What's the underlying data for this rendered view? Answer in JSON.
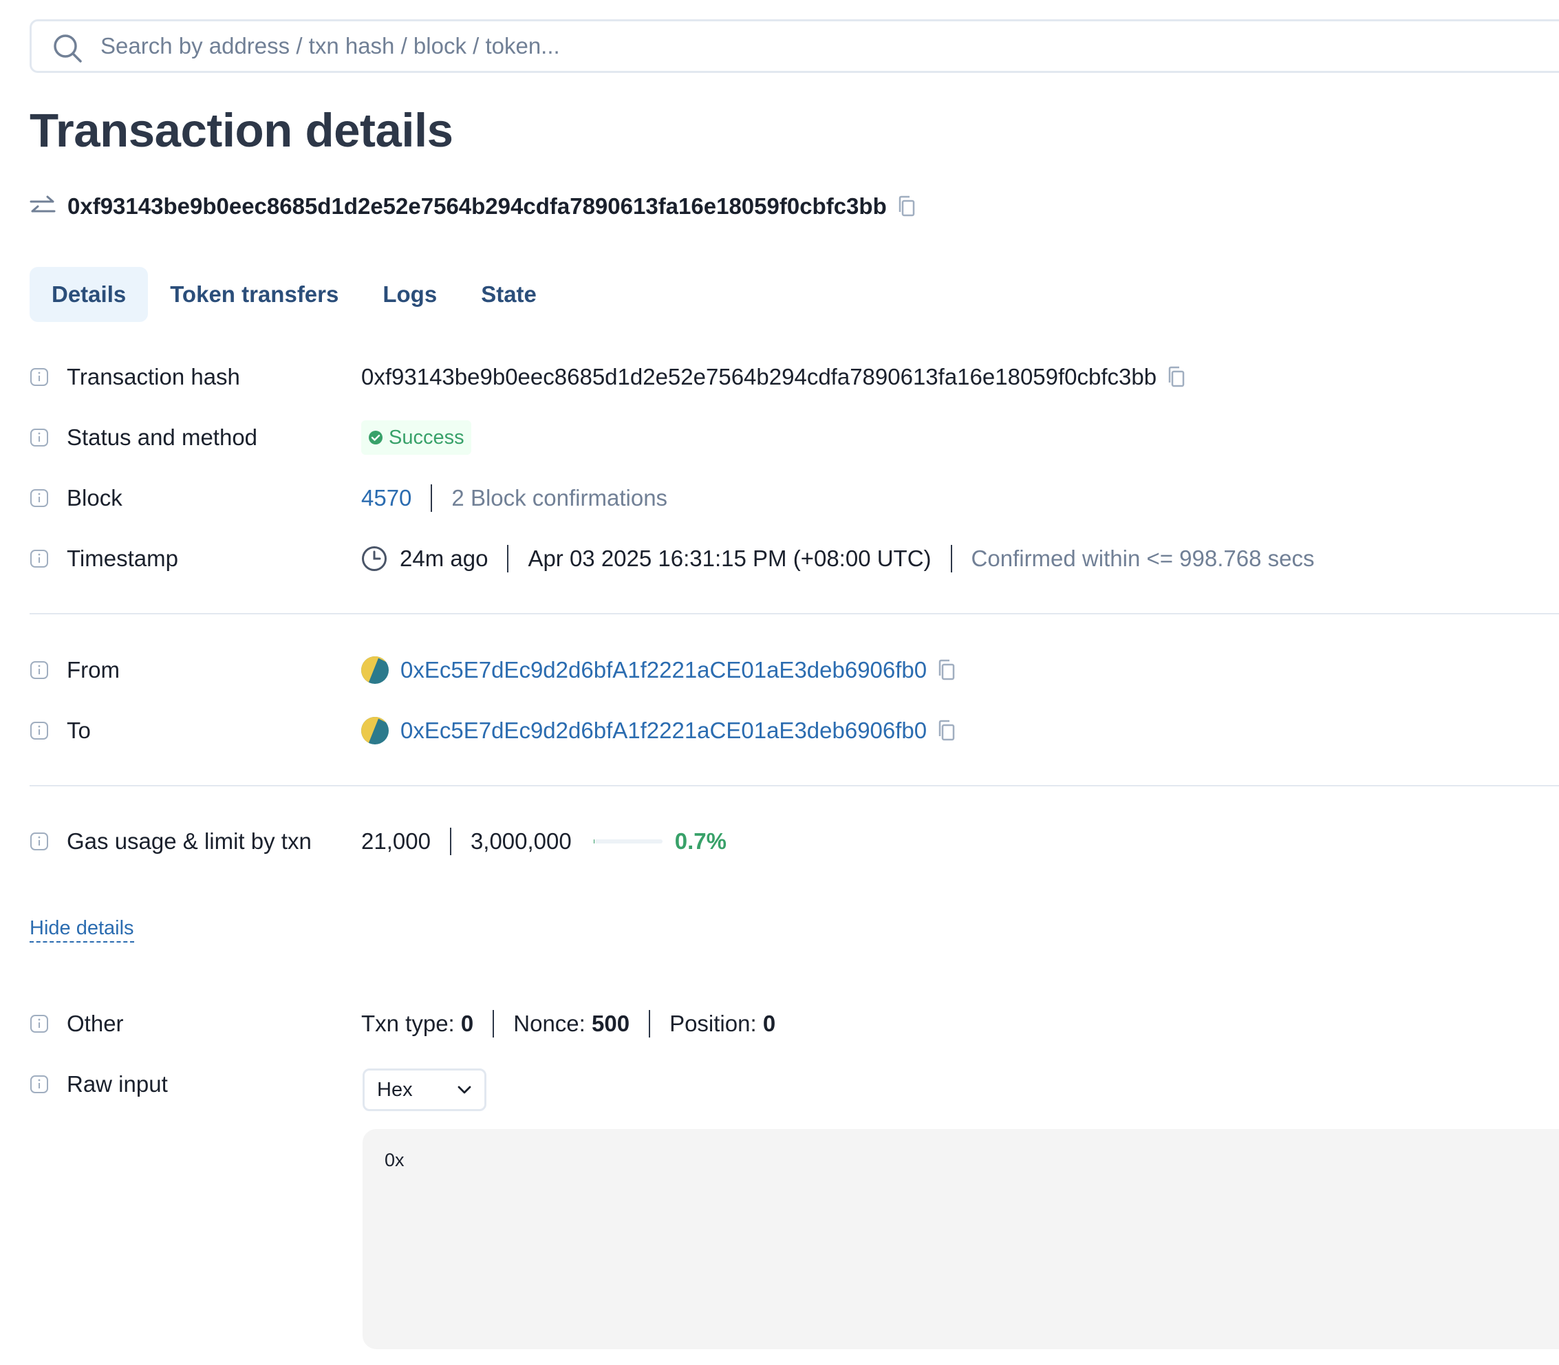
{
  "search": {
    "placeholder": "Search by address / txn hash / block / token..."
  },
  "page_title": "Transaction details",
  "header_hash": "0xf93143be9b0eec8685d1d2e52e7564b294cdfa7890613fa16e18059f0cbfc3bb",
  "tabs": [
    {
      "label": "Details",
      "active": true
    },
    {
      "label": "Token transfers"
    },
    {
      "label": "Logs"
    },
    {
      "label": "State"
    }
  ],
  "details": {
    "tx_hash": {
      "label": "Transaction hash",
      "value": "0xf93143be9b0eec8685d1d2e52e7564b294cdfa7890613fa16e18059f0cbfc3bb"
    },
    "status": {
      "label": "Status and method",
      "value": "Success"
    },
    "block": {
      "label": "Block",
      "number": "4570",
      "confirmations": "2 Block confirmations"
    },
    "timestamp": {
      "label": "Timestamp",
      "ago": "24m ago",
      "datetime": "Apr 03 2025 16:31:15 PM (+08:00 UTC)",
      "confirmed": "Confirmed within <= 998.768 secs"
    },
    "from": {
      "label": "From",
      "address": "0xEc5E7dEc9d2d6bfA1f2221aCE01aE3deb6906fb0"
    },
    "to": {
      "label": "To",
      "address": "0xEc5E7dEc9d2d6bfA1f2221aCE01aE3deb6906fb0"
    },
    "gas": {
      "label": "Gas usage & limit by txn",
      "usage": "21,000",
      "limit": "3,000,000",
      "percent_text": "0.7%",
      "percent": 0.7
    },
    "hide_details": "Hide details",
    "other": {
      "label": "Other",
      "txn_type_label": "Txn type:",
      "txn_type": "0",
      "nonce_label": "Nonce:",
      "nonce": "500",
      "position_label": "Position:",
      "position": "0"
    },
    "raw_input": {
      "label": "Raw input",
      "format": "Hex",
      "value": "0x"
    }
  },
  "colors": {
    "accent": "#2b6cb0",
    "success": "#38a169",
    "tab_active_bg": "#ebf4fc"
  },
  "icons": [
    "search-icon",
    "swap-arrows-icon",
    "copy-icon",
    "info-icon",
    "check-circle-icon",
    "clock-icon",
    "address-avatar-icon",
    "chevron-down-icon"
  ]
}
